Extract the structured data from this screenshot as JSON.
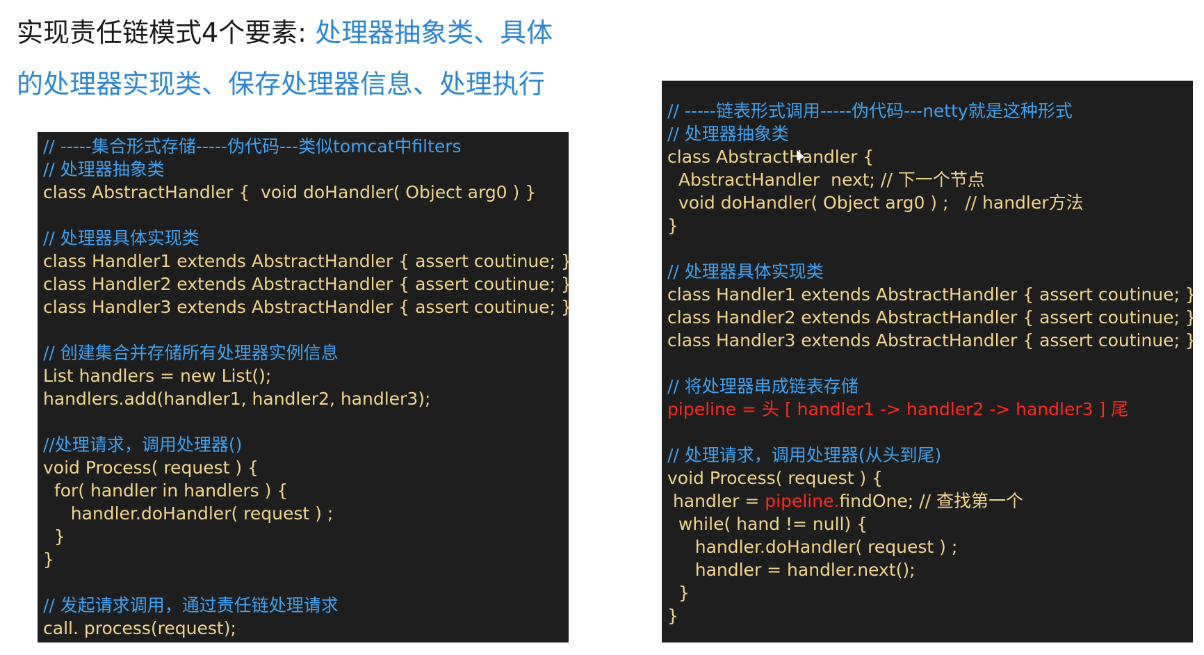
{
  "heading": {
    "line1_plain": "实现责任链模式4个要素: ",
    "line1_blue": "处理器抽象类、具体",
    "line2_blue": "的处理器实现类、保存处理器信息、处理执行"
  },
  "left_panel": {
    "lines": [
      {
        "type": "comment",
        "text": "// -----集合形式存储-----伪代码---类似tomcat中filters"
      },
      {
        "type": "comment",
        "text": "// 处理器抽象类"
      },
      {
        "type": "code",
        "text": "class AbstractHandler {  void doHandler( Object arg0 ) }"
      },
      {
        "type": "blank",
        "text": ""
      },
      {
        "type": "comment",
        "text": "// 处理器具体实现类"
      },
      {
        "type": "code",
        "text": "class Handler1 extends AbstractHandler { assert coutinue; }"
      },
      {
        "type": "code",
        "text": "class Handler2 extends AbstractHandler { assert coutinue; }"
      },
      {
        "type": "code",
        "text": "class Handler3 extends AbstractHandler { assert coutinue; }"
      },
      {
        "type": "blank",
        "text": ""
      },
      {
        "type": "comment",
        "text": "// 创建集合并存储所有处理器实例信息"
      },
      {
        "type": "code",
        "text": "List handlers = new List();"
      },
      {
        "type": "code",
        "text": "handlers.add(handler1, handler2, handler3);"
      },
      {
        "type": "blank",
        "text": ""
      },
      {
        "type": "comment",
        "text": "//处理请求，调用处理器()"
      },
      {
        "type": "code",
        "text": "void Process( request ) {"
      },
      {
        "type": "code",
        "text": "  for( handler in handlers ) {"
      },
      {
        "type": "code",
        "text": "     handler.doHandler( request ) ;"
      },
      {
        "type": "code",
        "text": "  }"
      },
      {
        "type": "code",
        "text": "}"
      },
      {
        "type": "blank",
        "text": ""
      },
      {
        "type": "comment",
        "text": "// 发起请求调用，通过责任链处理请求"
      },
      {
        "type": "code",
        "text": "call. process(request);"
      }
    ]
  },
  "right_panel": {
    "lines": [
      {
        "type": "mixed-comment",
        "parts": [
          {
            "c": "plain",
            "t": "// -----链表形式调用-----伪代码---netty就是这种形式"
          }
        ]
      },
      {
        "type": "comment",
        "text": "// 处理器抽象类"
      },
      {
        "type": "code",
        "text": "class AbstractHandler {"
      },
      {
        "type": "code",
        "text": "  AbstractHandler  next; // 下一个节点"
      },
      {
        "type": "code",
        "text": "  void doHandler( Object arg0 ) ;   // handler方法"
      },
      {
        "type": "code",
        "text": "}"
      },
      {
        "type": "blank",
        "text": ""
      },
      {
        "type": "comment",
        "text": "// 处理器具体实现类"
      },
      {
        "type": "code",
        "text": "class Handler1 extends AbstractHandler { assert coutinue; }"
      },
      {
        "type": "code",
        "text": "class Handler2 extends AbstractHandler { assert coutinue; }"
      },
      {
        "type": "code",
        "text": "class Handler3 extends AbstractHandler { assert coutinue; }"
      },
      {
        "type": "blank",
        "text": ""
      },
      {
        "type": "comment",
        "text": "// 将处理器串成链表存储"
      },
      {
        "type": "red",
        "text": "pipeline = 头 [ handler1 -> handler2 -> handler3 ] 尾"
      },
      {
        "type": "blank",
        "text": ""
      },
      {
        "type": "comment",
        "text": "// 处理请求，调用处理器(从头到尾)"
      },
      {
        "type": "code",
        "text": "void Process( request ) {"
      },
      {
        "type": "mixed",
        "parts": [
          {
            "c": "plain",
            "t": " handler = "
          },
          {
            "c": "red",
            "t": "pipeline."
          },
          {
            "c": "plain",
            "t": "findOne; // 查找第一个"
          }
        ]
      },
      {
        "type": "code",
        "text": "  while( hand != null) {"
      },
      {
        "type": "code",
        "text": "     handler.doHandler( request ) ;"
      },
      {
        "type": "code",
        "text": "     handler = handler.next();"
      },
      {
        "type": "code",
        "text": "  }"
      },
      {
        "type": "code",
        "text": "}"
      }
    ]
  }
}
